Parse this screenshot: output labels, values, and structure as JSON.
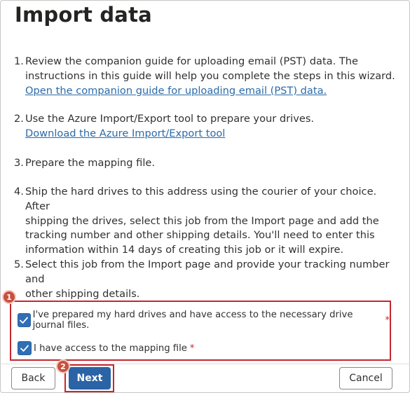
{
  "dialog": {
    "title": "Import data"
  },
  "steps": [
    {
      "number": "1.",
      "lines": [
        "Review the companion guide for uploading email (PST) data. The",
        "instructions in this guide will help you complete the steps in this wizard."
      ],
      "link": "Open the companion guide for uploading email (PST) data."
    },
    {
      "number": "2.",
      "lines": [
        "Use the Azure Import/Export tool to prepare your drives."
      ],
      "link": "Download the Azure Import/Export tool"
    },
    {
      "number": "3.",
      "lines": [
        "Prepare the mapping file."
      ]
    },
    {
      "number": "4.",
      "lines": [
        "Ship the hard drives to this address using the courier of your choice. After",
        "shipping the drives, select this job from the Import page and add the",
        "tracking number and other shipping details. You'll need to enter this",
        "information within 14 days of creating this job or it will expire."
      ]
    },
    {
      "number": "5.",
      "lines": [
        "Select this job from the Import page and provide your tracking number and",
        "other shipping details."
      ]
    }
  ],
  "confirmations": [
    {
      "label": "I've prepared my hard drives and have access to the necessary drive journal files.",
      "required_mark": "*",
      "checked": true
    },
    {
      "label": "I have access to the mapping file",
      "required_mark": "*",
      "checked": true
    }
  ],
  "annotations": {
    "badge_1": "1",
    "badge_2": "2",
    "highlight_color": "#c4282e"
  },
  "footer": {
    "back_label": "Back",
    "next_label": "Next",
    "cancel_label": "Cancel"
  },
  "colors": {
    "primary": "#2a63a6",
    "link": "#2b6ba8",
    "required": "#c4282e"
  }
}
